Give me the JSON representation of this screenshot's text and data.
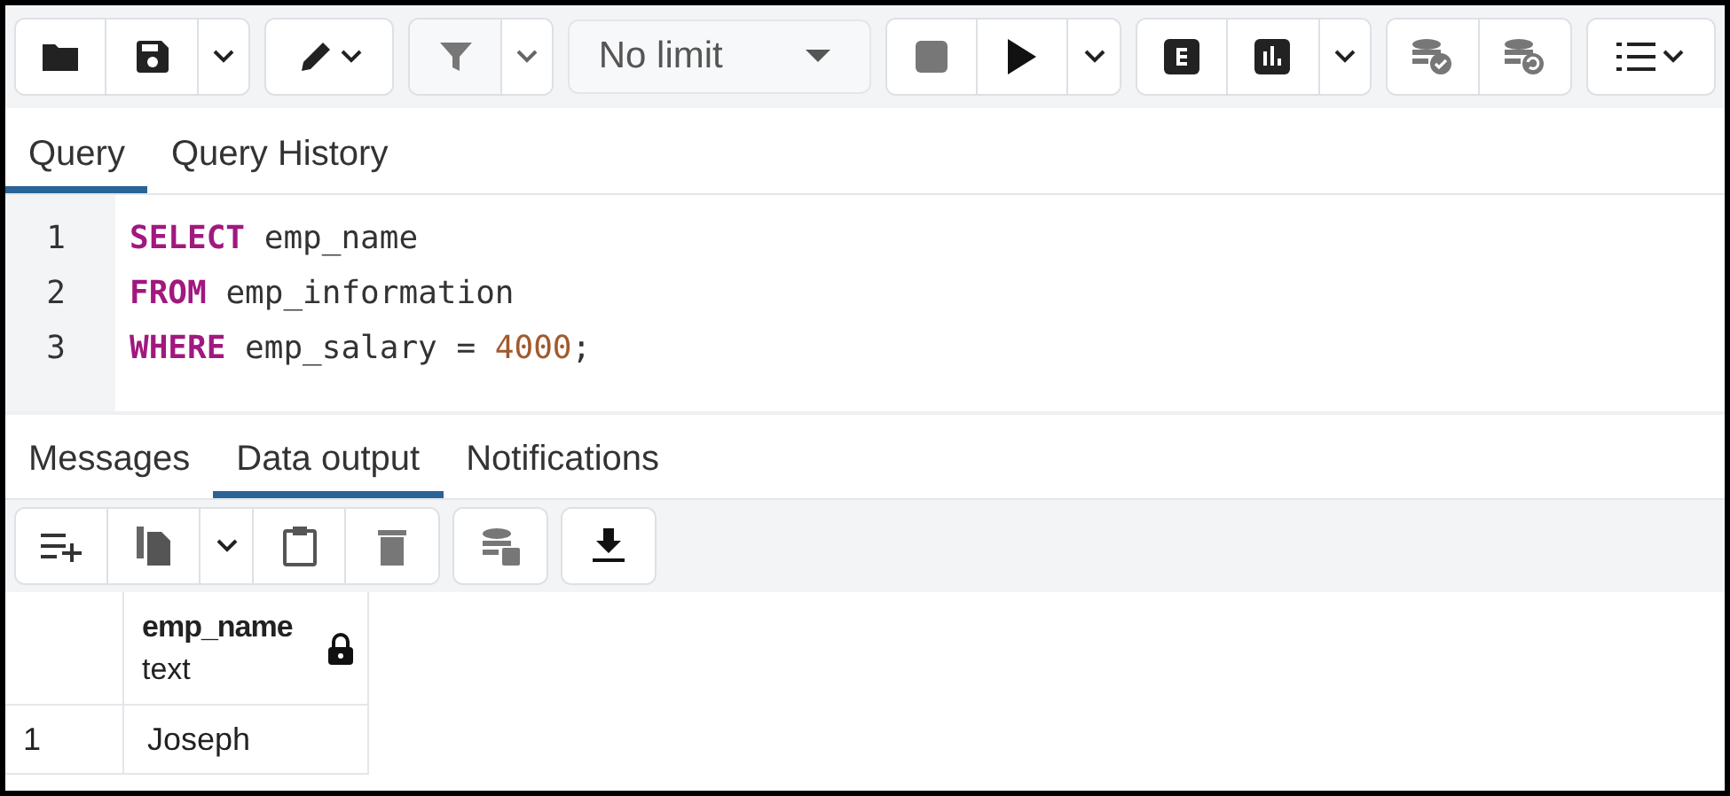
{
  "toolbar": {
    "limit": "No limit",
    "filter_disabled": true,
    "stop_disabled": true
  },
  "editor_tabs": [
    {
      "label": "Query",
      "selected": true
    },
    {
      "label": "Query History",
      "selected": false
    }
  ],
  "editor": {
    "lines": [
      {
        "number": "1",
        "tokens": [
          {
            "kind": "keyword",
            "text": "SELECT"
          },
          {
            "kind": "plain",
            "text": " emp_name"
          }
        ]
      },
      {
        "number": "2",
        "tokens": [
          {
            "kind": "keyword",
            "text": "FROM"
          },
          {
            "kind": "plain",
            "text": " emp_information"
          }
        ]
      },
      {
        "number": "3",
        "tokens": [
          {
            "kind": "keyword",
            "text": "WHERE"
          },
          {
            "kind": "plain",
            "text": " emp_salary = "
          },
          {
            "kind": "number",
            "text": "4000"
          },
          {
            "kind": "plain",
            "text": ";"
          }
        ]
      }
    ]
  },
  "result_tabs": [
    {
      "label": "Messages",
      "selected": false
    },
    {
      "label": "Data output",
      "selected": true
    },
    {
      "label": "Notifications",
      "selected": false
    }
  ],
  "data_toolbar": {
    "delete_disabled": true,
    "save_disabled": true
  },
  "table": {
    "columns": [
      {
        "name": "emp_name",
        "type": "text",
        "locked": true
      }
    ],
    "rows": [
      {
        "number": "1",
        "cells": [
          "Joseph"
        ]
      }
    ]
  }
}
